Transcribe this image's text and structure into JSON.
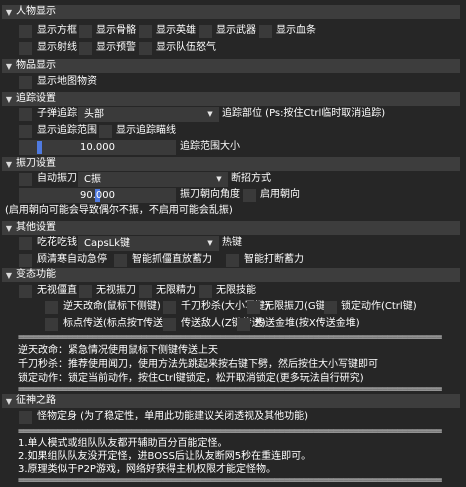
{
  "sections": {
    "char": {
      "title": "人物显示",
      "options": [
        "显示方框",
        "显示骨骼",
        "显示英雄",
        "显示武器",
        "显示血条",
        "显示射线",
        "显示预警",
        "显示队伍怒气"
      ]
    },
    "items": {
      "title": "物品显示",
      "options": [
        "显示地图物资"
      ]
    },
    "track": {
      "title": "追踪设置",
      "bullet_label": "子弹追踪",
      "part_value": "头部",
      "part_label": "追踪部位 (Ps:按住Ctrl临时取消追踪)",
      "show_range": "显示追踪范围",
      "show_aim": "显示追踪瞄线",
      "range_value": "10.000",
      "range_label": "追踪范围大小"
    },
    "blade": {
      "title": "振刀设置",
      "auto_label": "自动振刀",
      "type_value": "C振",
      "type_label": "断招方式",
      "angle_value": "90.000",
      "angle_label": "振刀朝向角度",
      "enable_dir": "启用朝向",
      "note": "(启用朝向可能会导致偶尔不振，不启用可能会乱振)"
    },
    "other": {
      "title": "其他设置",
      "eat_label": "吃花吃钱",
      "key_value": "CapsLk键",
      "key_label": "热键",
      "cold_stop": "顾清寒自动急停",
      "smart_grab": "智能抓僵直放蓄力",
      "smart_block": "智能打断蓄力"
    },
    "cheat": {
      "title": "变态功能",
      "options": [
        "无视僵直",
        "无视振刀",
        "无限精力",
        "无限技能",
        "逆天改命(鼠标下侧键)",
        "千刀秒杀(大小写键)",
        "无限振刀(G键)",
        "锁定动作(Ctrl键)",
        "标点传送(标点按T传送)",
        "传送敌人(Z键传送)",
        "传送金堆(按X传送金堆)"
      ],
      "separator": "======================================================================================",
      "desc": [
        "逆天改命：紧急情况使用鼠标下侧键传送上天",
        "千刀秒杀：推荐使用闻刀，使用方法先跳起来按右键下劈，然后按住大小写键即可",
        "锁定动作：锁定当前动作，按住Ctrl键锁定，松开取消锁定(更多玩法自行研究)"
      ]
    },
    "quest": {
      "title": "征神之路",
      "monster": "怪物定身 (为了稳定性，单用此功能建议关闭透视及其他功能)",
      "notes": [
        "1.单人模式或组队队友都开辅助百分百能定怪。",
        "2.如果组队队友没开定怪，进BOSS后让队友断网5秒在重连即可。",
        "3.原理类似于P2P游戏，网络好获得主机权限才能定怪物。"
      ]
    }
  },
  "colors": {
    "background": "#262626",
    "header": "#3d3d3d",
    "frame": "#3a3a3a",
    "slider_grab": "#4f7ae0",
    "text": "#ffffff"
  }
}
